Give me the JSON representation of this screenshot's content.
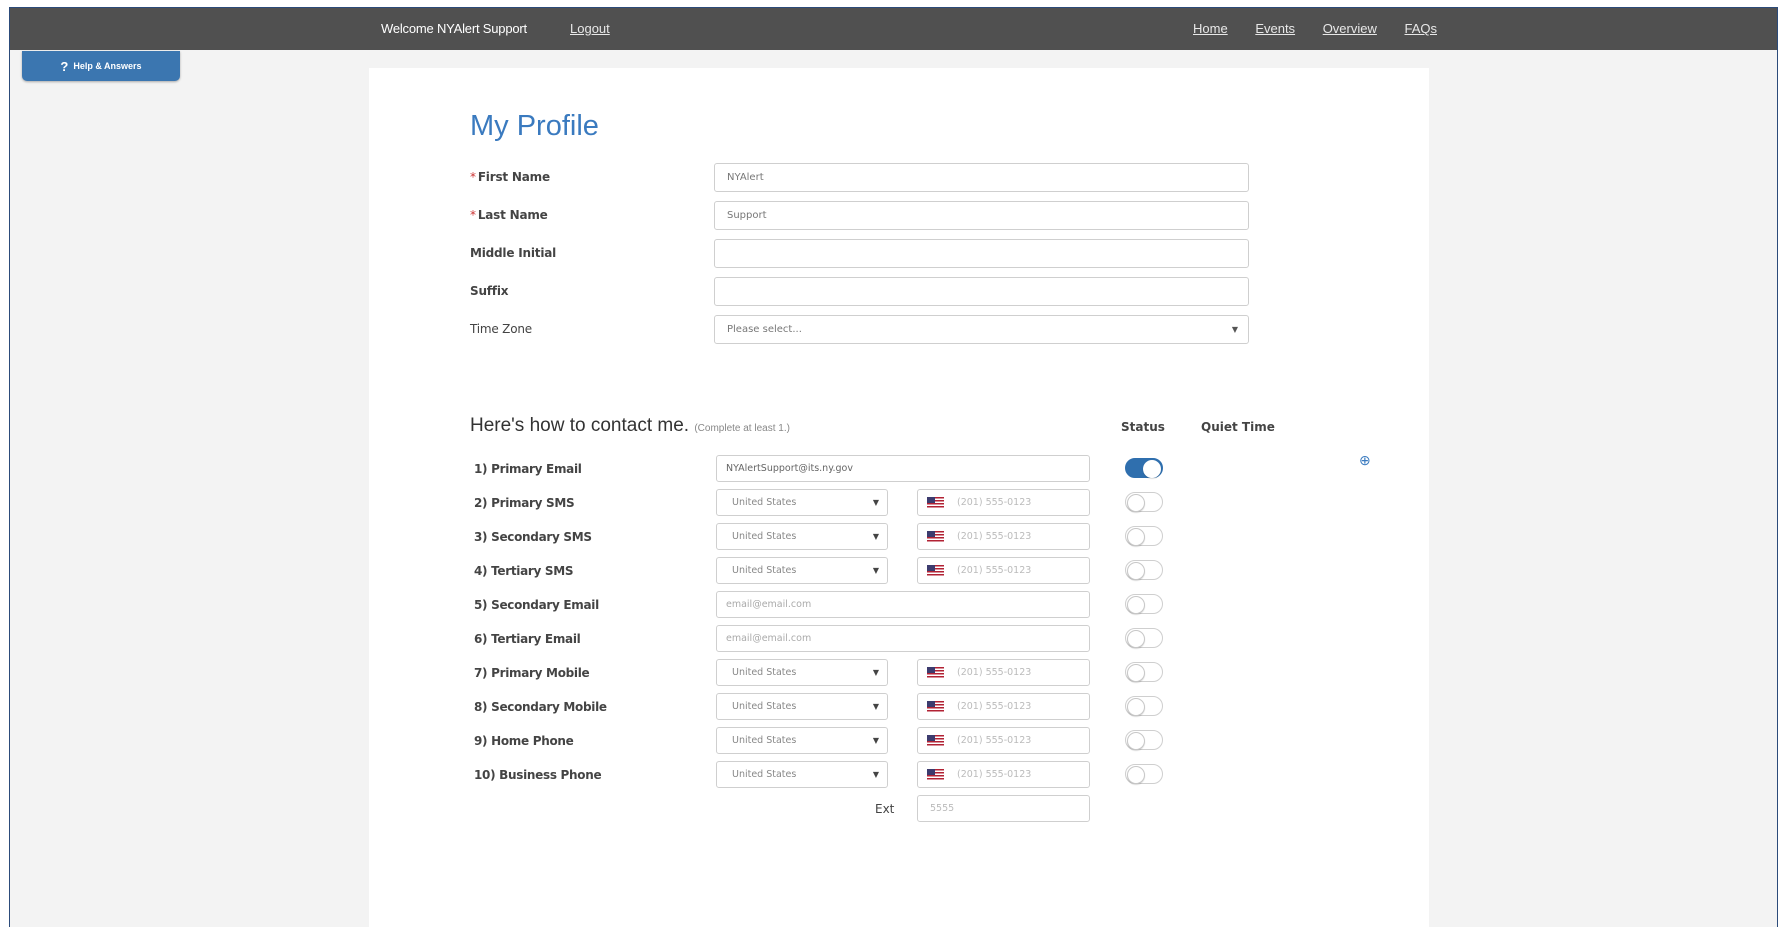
{
  "nav": {
    "welcome": "Welcome NYAlert Support",
    "logout": "Logout",
    "links": [
      "Home",
      "Events",
      "Overview",
      "FAQs"
    ]
  },
  "help": {
    "label": "Help & Answers"
  },
  "profile": {
    "title": "My Profile",
    "fields": {
      "first_name": {
        "label": "First Name",
        "value": "NYAlert"
      },
      "last_name": {
        "label": "Last Name",
        "value": "Support"
      },
      "middle_initial": {
        "label": "Middle Initial",
        "value": ""
      },
      "suffix": {
        "label": "Suffix",
        "value": ""
      },
      "time_zone": {
        "label": "Time Zone",
        "value": "Please select..."
      }
    }
  },
  "contact": {
    "title": "Here's how to contact me.",
    "subtitle": "(Complete at least 1.)",
    "status_header": "Status",
    "quiet_time_header": "Quiet Time",
    "rows": [
      {
        "label": "1) Primary Email",
        "value": "NYAlertSupport@its.ny.gov"
      },
      {
        "label": "2) Primary SMS",
        "country": "United States",
        "phone_placeholder": "(201) 555-0123"
      },
      {
        "label": "3) Secondary SMS",
        "country": "United States",
        "phone_placeholder": "(201) 555-0123"
      },
      {
        "label": "4) Tertiary SMS",
        "country": "United States",
        "phone_placeholder": "(201) 555-0123"
      },
      {
        "label": "5) Secondary Email",
        "placeholder": "email@email.com"
      },
      {
        "label": "6) Tertiary Email",
        "placeholder": "email@email.com"
      },
      {
        "label": "7) Primary Mobile",
        "country": "United States",
        "phone_placeholder": "(201) 555-0123"
      },
      {
        "label": "8) Secondary Mobile",
        "country": "United States",
        "phone_placeholder": "(201) 555-0123"
      },
      {
        "label": "9) Home Phone",
        "country": "United States",
        "phone_placeholder": "(201) 555-0123"
      },
      {
        "label": "10) Business Phone",
        "country": "United States",
        "phone_placeholder": "(201) 555-0123"
      }
    ],
    "ext_label": "Ext",
    "ext_placeholder": "5555"
  }
}
